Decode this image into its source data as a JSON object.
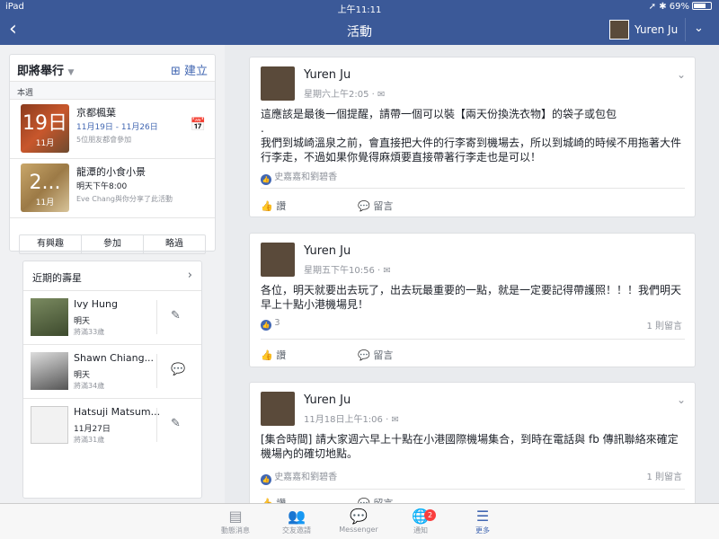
{
  "status": {
    "device": "iPad",
    "time": "上午11:11",
    "battery": "69%"
  },
  "header": {
    "title": "活動",
    "user": "Yuren Ju"
  },
  "upcoming": {
    "title": "即將舉行",
    "create": "建立",
    "week": "本週",
    "events": [
      {
        "day": "19日",
        "month": "11月",
        "name": "京都楓葉",
        "date": "11月19日 - 11月26日",
        "sub": "5位朋友都會參加"
      },
      {
        "day": "2...",
        "month": "11月",
        "name": "龍潭的小食小景",
        "date": "明天下午8:00",
        "sub": "Eve Chang與你分享了此活動"
      }
    ],
    "rsvp": [
      "有興趣",
      "參加",
      "略過"
    ]
  },
  "birthdays": {
    "title": "近期的壽星",
    "people": [
      {
        "name": "Ivy Hung",
        "when": "明天",
        "age": "將滿33歲"
      },
      {
        "name": "Shawn Chiang...",
        "when": "明天",
        "age": "將滿34歲"
      },
      {
        "name": "Hatsuji Matsum...",
        "when": "11月27日",
        "age": "將滿31歲"
      }
    ]
  },
  "posts": [
    {
      "author": "Yuren Ju",
      "time": "星期六上午2:05 · ✉",
      "body": "這應該是最後一個提醒，請帶一個可以裝【兩天份換洗衣物】的袋子或包包\n.\n我們到城崎溫泉之前，會直接把大件的行李寄到機場去，所以到城崎的時候不用拖著大件行李走，不過如果你覺得麻煩要直接帶著行李走也是可以！",
      "likes": "史嘉嘉和劉碧香",
      "comments": ""
    },
    {
      "author": "Yuren Ju",
      "time": "星期五下午10:56 · ✉",
      "body": "各位，明天就要出去玩了，出去玩最重要的一點，就是一定要記得帶護照！！！我們明天早上十點小港機場見！",
      "likes": "3",
      "comments": "1 則留言"
    },
    {
      "author": "Yuren Ju",
      "time": "11月18日上午1:06 · ✉",
      "body": "[集合時間] 請大家週六早上十點在小港國際機場集合，到時在電話與 fb 傳訊聯絡來確定機場內的確切地點。",
      "likes": "史嘉嘉和劉碧香",
      "comments": "1 則留言"
    }
  ],
  "actions": {
    "like": "讚",
    "comment": "留言"
  },
  "tabs": [
    {
      "label": "動態消息",
      "icon": "news-feed-icon"
    },
    {
      "label": "交友邀請",
      "icon": "friend-requests-icon"
    },
    {
      "label": "Messenger",
      "icon": "messenger-icon"
    },
    {
      "label": "通知",
      "icon": "globe-icon",
      "badge": "2"
    },
    {
      "label": "更多",
      "icon": "menu-icon"
    }
  ]
}
